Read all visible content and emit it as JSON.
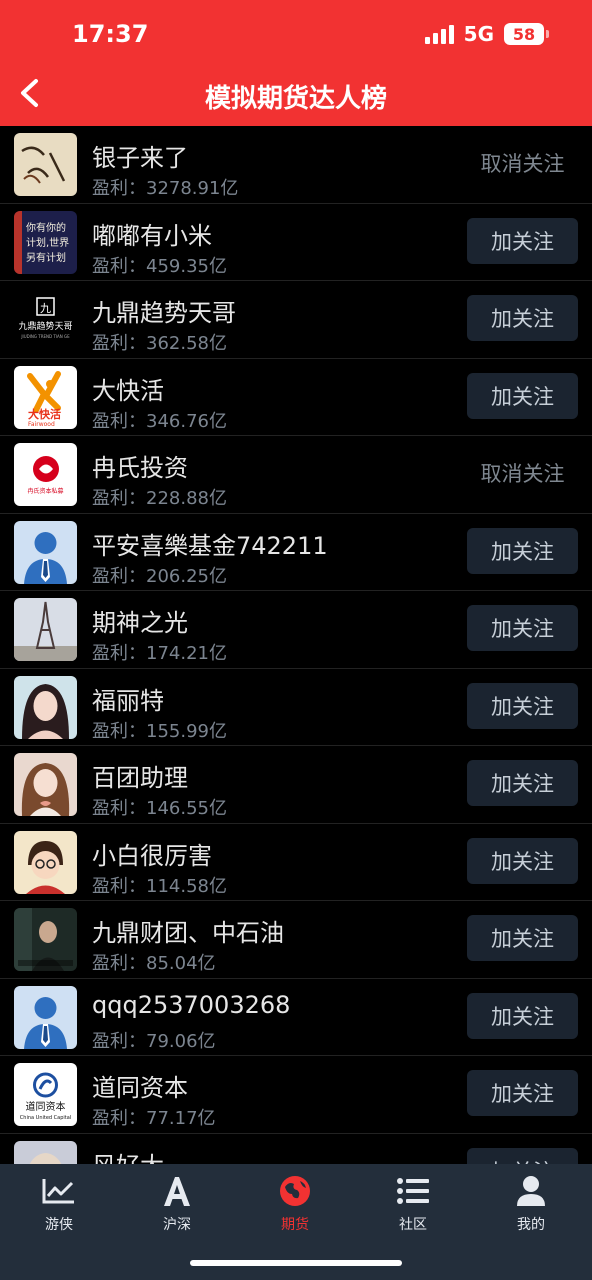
{
  "status": {
    "time": "17:37",
    "network": "5G",
    "battery": "58"
  },
  "header": {
    "title": "模拟期货达人榜"
  },
  "rows": [
    {
      "name": "银子来了",
      "profit": "盈利：3278.91亿",
      "button": "取消关注",
      "following": true
    },
    {
      "name": "嘟嘟有小米",
      "profit": "盈利：459.35亿",
      "button": "加关注",
      "following": false
    },
    {
      "name": "九鼎趋势天哥",
      "profit": "盈利：362.58亿",
      "button": "加关注",
      "following": false
    },
    {
      "name": "大快活",
      "profit": "盈利：346.76亿",
      "button": "加关注",
      "following": false
    },
    {
      "name": "冉氏投资",
      "profit": "盈利：228.88亿",
      "button": "取消关注",
      "following": true
    },
    {
      "name": "平安喜樂基金742211",
      "profit": "盈利：206.25亿",
      "button": "加关注",
      "following": false
    },
    {
      "name": "期神之光",
      "profit": "盈利：174.21亿",
      "button": "加关注",
      "following": false
    },
    {
      "name": "福丽特",
      "profit": "盈利：155.99亿",
      "button": "加关注",
      "following": false
    },
    {
      "name": "百团助理",
      "profit": "盈利：146.55亿",
      "button": "加关注",
      "following": false
    },
    {
      "name": "小白很厉害",
      "profit": "盈利：114.58亿",
      "button": "加关注",
      "following": false
    },
    {
      "name": "九鼎财团、中石油",
      "profit": "盈利：85.04亿",
      "button": "加关注",
      "following": false
    },
    {
      "name": "qqq2537003268",
      "profit": "盈利：79.06亿",
      "button": "加关注",
      "following": false
    },
    {
      "name": "道同资本",
      "profit": "盈利：77.17亿",
      "button": "加关注",
      "following": false
    },
    {
      "name": "风好大",
      "profit": "",
      "button": "加关注",
      "following": false
    }
  ],
  "avatars": {
    "a0": {
      "text": "明"
    },
    "a1": {
      "text": "你有你的计划,世界另有计划"
    },
    "a2": {
      "text": "九鼎趋势天哥",
      "sub": "JIUDING TREND TIAN GE"
    },
    "a3": {
      "text": "大快活",
      "sub": "Fairwood"
    },
    "a4": {
      "text": "冉氏资本私募"
    },
    "a12": {
      "text": "道同资本",
      "sub": "China United Capital"
    }
  },
  "tabs": [
    {
      "label": "游侠",
      "icon": "chart-line-icon"
    },
    {
      "label": "沪深",
      "icon": "letter-a-icon"
    },
    {
      "label": "期货",
      "icon": "globe-icon"
    },
    {
      "label": "社区",
      "icon": "list-icon"
    },
    {
      "label": "我的",
      "icon": "user-icon"
    }
  ],
  "colors": {
    "brand": "#f23232",
    "background": "#000000",
    "tabbar": "#232e3b",
    "button": "#1b2430"
  }
}
